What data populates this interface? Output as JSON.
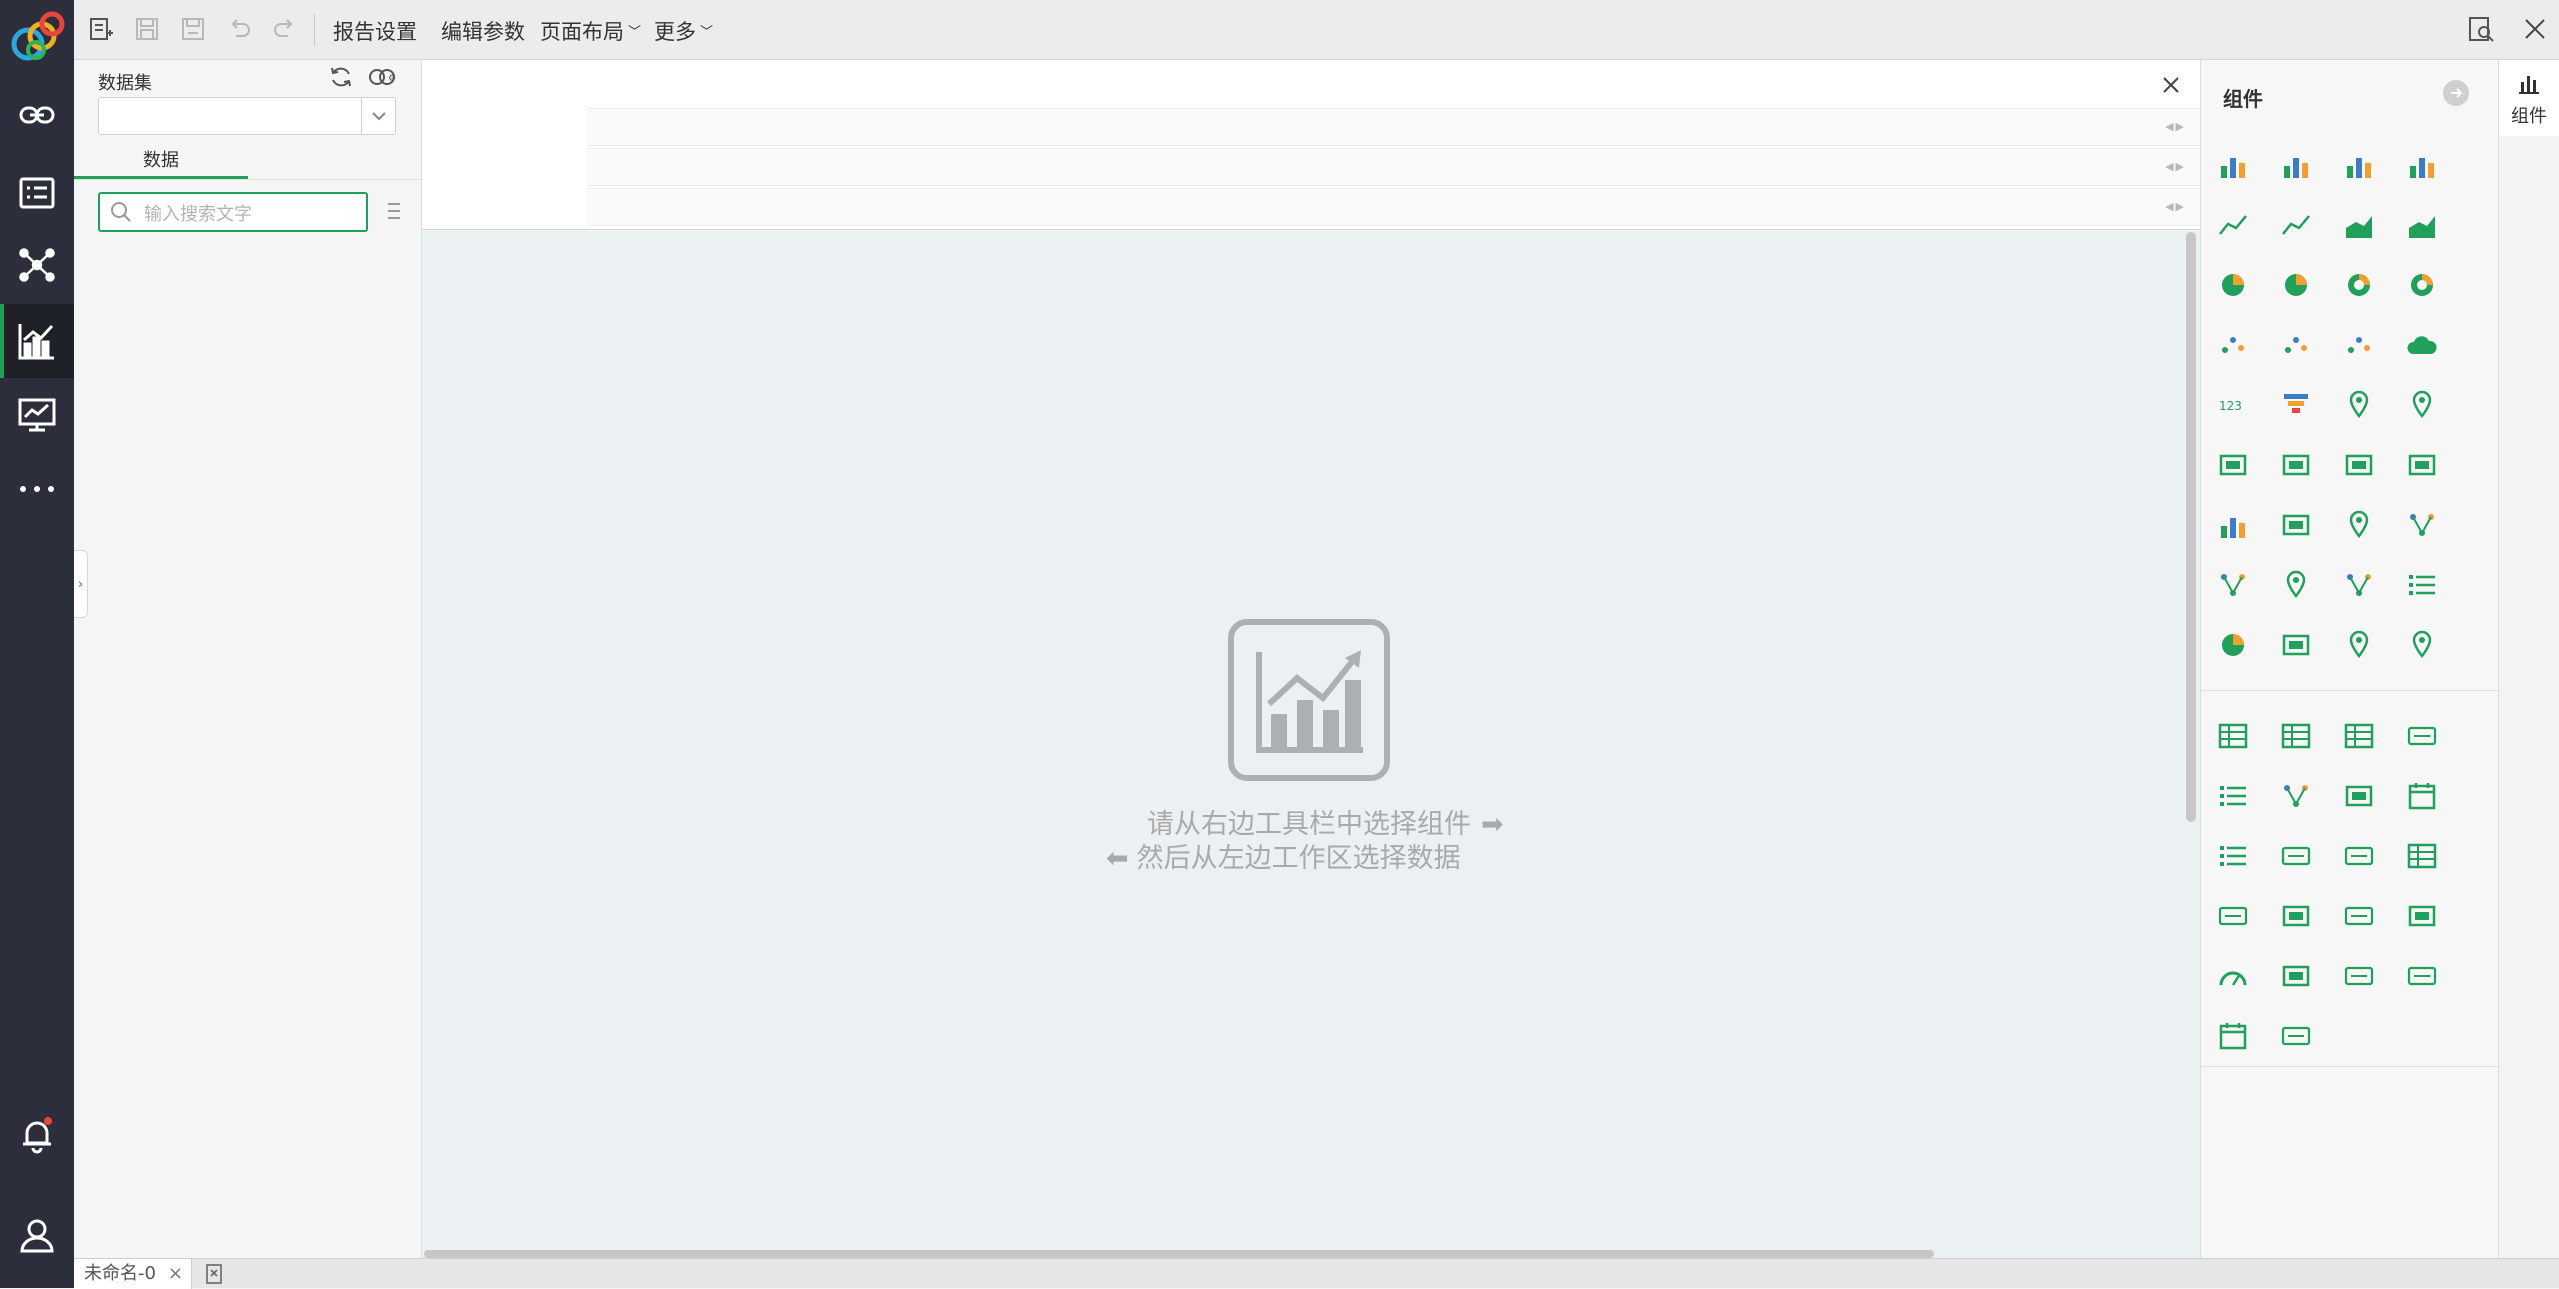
{
  "toolbar": {
    "report_settings": "报告设置",
    "edit_params": "编辑参数",
    "page_layout": "页面布局",
    "more": "更多"
  },
  "data_panel": {
    "dataset_label": "数据集",
    "dataset_value": "",
    "data_tab": "数据",
    "search_placeholder": "输入搜索文字"
  },
  "workspace": {
    "hint_line1": "请从右边工具栏中选择组件",
    "hint_line2": "然后从左边工作区选择数据"
  },
  "component_panel": {
    "title": "组件",
    "chart_icons": [
      "bar-chart-icon",
      "grouped-bar-chart-icon",
      "stacked-bar-chart-icon",
      "percent-stacked-bar-chart-icon",
      "line-chart-icon",
      "multi-line-chart-icon",
      "area-chart-icon",
      "stacked-area-chart-icon",
      "pie-chart-icon",
      "3d-pie-chart-icon",
      "donut-chart-icon",
      "ring-chart-icon",
      "scatter-chart-icon",
      "dot-chart-icon",
      "bubble-chart-icon",
      "word-cloud-icon",
      "number-card-icon",
      "funnel-chart-icon",
      "world-map-icon",
      "location-map-icon",
      "parallel-chart-icon",
      "3d-surface-chart-icon",
      "waterfall-chart-icon",
      "combo-chart-icon",
      "histogram-icon",
      "boxplot-icon",
      "treemap-icon",
      "network-graph-icon",
      "sankey-chart-icon",
      "heat-map-icon",
      "tree-chart-icon",
      "ranking-list-icon",
      "globe-map-icon",
      "candlestick-chart-icon",
      "flow-map-icon",
      "route-map-icon"
    ],
    "widget_icons": [
      "table-icon",
      "pivot-table-icon",
      "crosstab-icon",
      "text-box-icon",
      "list-filter-icon",
      "tree-filter-icon",
      "slider-filter-icon",
      "date-filter-icon",
      "list-widget-icon",
      "dropdown-widget-icon",
      "text-input-icon",
      "edit-table-icon",
      "tab-container-icon",
      "image-widget-icon",
      "button-widget-icon",
      "web-page-icon",
      "gauge-icon",
      "layout-container-icon",
      "embedded-code-icon",
      "rich-text-icon",
      "timer-icon",
      "digital-clock-icon"
    ]
  },
  "rail": {
    "label": "组件"
  },
  "bottom": {
    "doc_tab": "未命名-0",
    "close": "×"
  },
  "colors": {
    "accent": "#20a05a",
    "nav_bg": "#2c2f3b",
    "canvas_bg": "#ebf1f3"
  }
}
